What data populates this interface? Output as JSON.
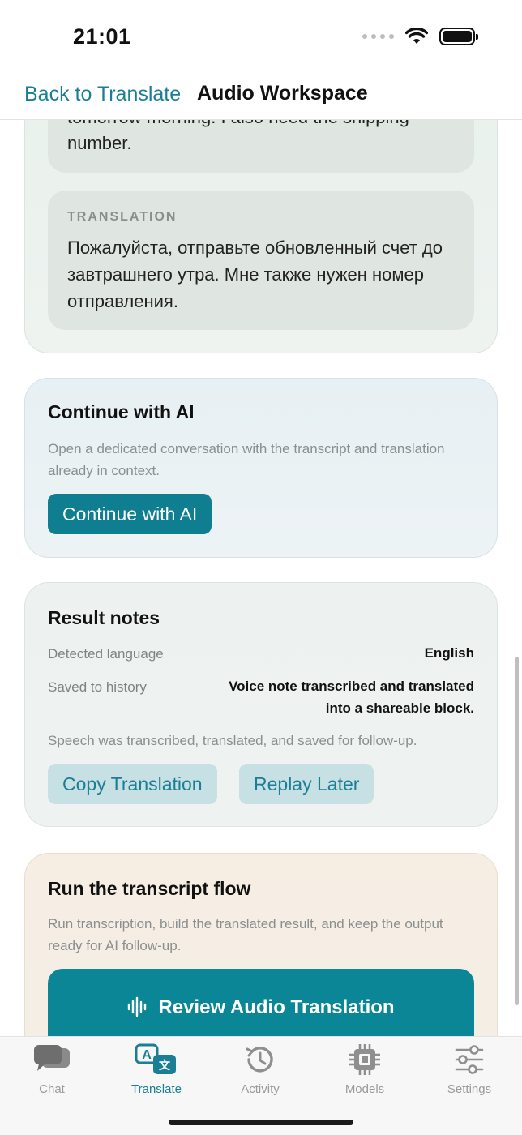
{
  "status_bar": {
    "time": "21:01"
  },
  "nav": {
    "back_label": "Back to Translate",
    "title": "Audio Workspace"
  },
  "transcript_card": {
    "source_text_partial_line1": "tomorrow morning. I also need the shipping",
    "source_text_partial_line2": "number.",
    "translation_eyebrow": "TRANSLATION",
    "translation_text": "Пожалуйста, отправьте обновленный счет до завтрашнего утра. Мне также нужен номер отправления."
  },
  "continue_card": {
    "title": "Continue with AI",
    "description": "Open a dedicated conversation with the transcript and translation already in context.",
    "button_label": "Continue with AI"
  },
  "result_notes": {
    "title": "Result notes",
    "detected_language_label": "Detected language",
    "detected_language_value": "English",
    "saved_label": "Saved to history",
    "saved_value": "Voice note transcribed and translated into a shareable block.",
    "footnote": "Speech was transcribed, translated, and saved for follow-up.",
    "copy_button": "Copy Translation",
    "replay_button": "Replay Later"
  },
  "flow_card": {
    "title": "Run the transcript flow",
    "description": "Run transcription, build the translated result, and keep the output ready for AI follow-up.",
    "button_label": "Review Audio Translation"
  },
  "tab_bar": {
    "items": [
      {
        "label": "Chat",
        "icon": "chat-bubbles-icon"
      },
      {
        "label": "Translate",
        "icon": "translate-icon"
      },
      {
        "label": "Activity",
        "icon": "history-clock-icon"
      },
      {
        "label": "Models",
        "icon": "chip-icon"
      },
      {
        "label": "Settings",
        "icon": "sliders-icon"
      }
    ],
    "active_index": 1
  },
  "colors": {
    "accent": "#1a7f95",
    "button_primary": "#0f7e90",
    "button_soft": "#c6e0e3"
  }
}
